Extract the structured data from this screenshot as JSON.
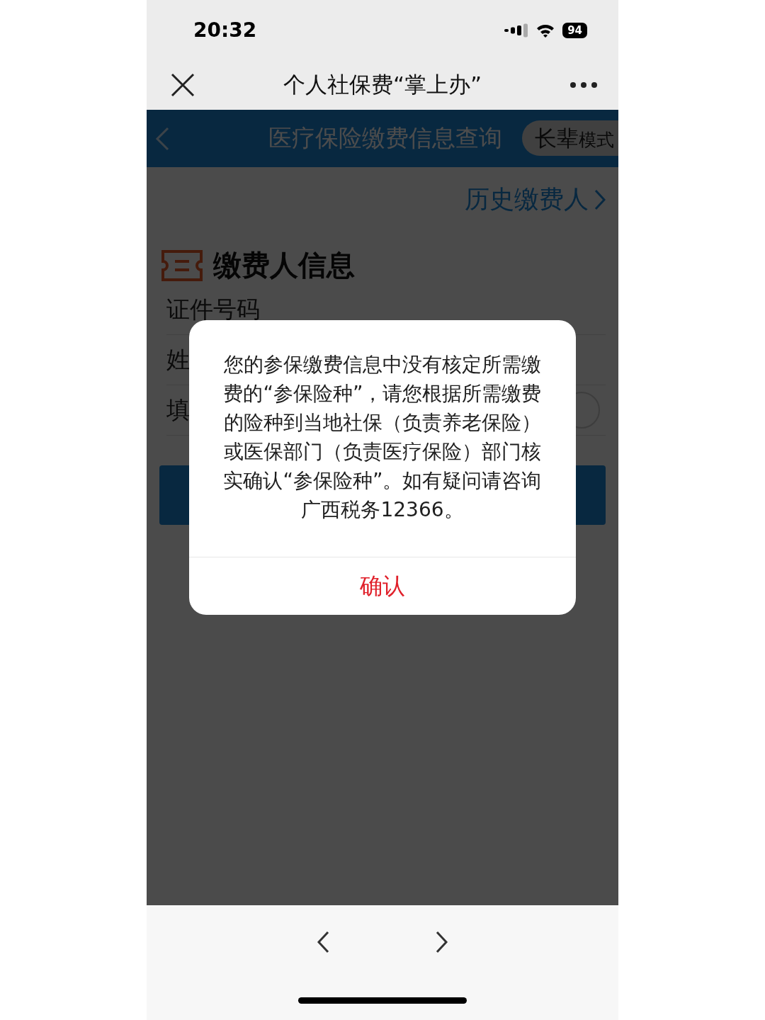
{
  "status_bar": {
    "time": "20:32",
    "battery": "94"
  },
  "header": {
    "title": "个人社保费“掌上办”"
  },
  "page_bar": {
    "title": "医疗保险缴费信息查询",
    "elder_label": "长辈",
    "elder_suffix": "模式"
  },
  "history_link": "历史缴费人",
  "section_title": "缴费人信息",
  "form_rows": [
    {
      "label": "证件号码"
    },
    {
      "label": "姓"
    },
    {
      "label": "填",
      "radio": {
        "selected": false
      }
    }
  ],
  "dialog": {
    "message": "您的参保缴费信息中没有核定所需缴费的“参保险种”，请您根据所需缴费的险种到当地社保（负责养老保险）或医保部门（负责医疗保险）部门核实确认“参保险种”。如有疑问请咨询广西税务12366。",
    "confirm": "确认"
  }
}
